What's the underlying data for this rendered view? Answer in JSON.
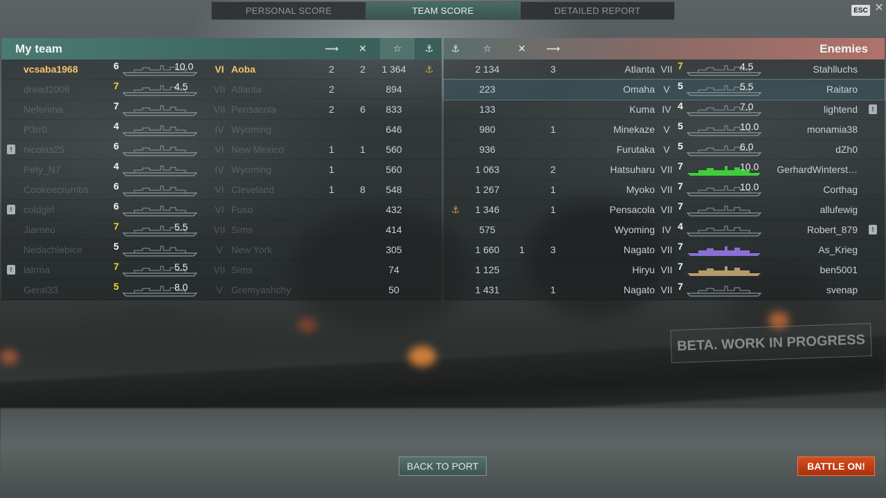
{
  "tabs": [
    {
      "label": "PERSONAL SCORE",
      "active": false
    },
    {
      "label": "TEAM SCORE",
      "active": true
    },
    {
      "label": "DETAILED REPORT",
      "active": false
    }
  ],
  "esc_label": "ESC",
  "my_team": {
    "title": "My team",
    "header_icons": [
      "torpedo-icon",
      "cross-swords-icon",
      "star-icon",
      "anchor-icon"
    ],
    "rows": [
      {
        "report": false,
        "name": "vcsaba1968",
        "tier": "6",
        "tier_color": "white",
        "value": "10.0",
        "ship_tier": "VI",
        "ship": "Aoba",
        "c1": "2",
        "c2": "2",
        "c3": "1 364",
        "c4": "⚓",
        "self": true,
        "dim": false,
        "sil_color": "#8d979c"
      },
      {
        "report": false,
        "name": "dread2006",
        "tier": "7",
        "tier_color": "yellow",
        "value": "4.5",
        "ship_tier": "VII",
        "ship": "Atlanta",
        "c1": "2",
        "c2": "",
        "c3": "894",
        "c4": "",
        "self": false,
        "dim": true,
        "sil_color": "#8d979c"
      },
      {
        "report": false,
        "name": "Neferima",
        "tier": "7",
        "tier_color": "white",
        "value": "",
        "ship_tier": "VII",
        "ship": "Pensacola",
        "c1": "2",
        "c2": "6",
        "c3": "833",
        "c4": "",
        "self": false,
        "dim": true,
        "sil_color": "#8d979c"
      },
      {
        "report": false,
        "name": "P3rr0",
        "tier": "4",
        "tier_color": "white",
        "value": "",
        "ship_tier": "IV",
        "ship": "Wyoming",
        "c1": "",
        "c2": "",
        "c3": "646",
        "c4": "",
        "self": false,
        "dim": true,
        "sil_color": "#8d979c"
      },
      {
        "report": true,
        "name": "nicolas25",
        "tier": "6",
        "tier_color": "white",
        "value": "",
        "ship_tier": "VI",
        "ship": "New Mexico",
        "c1": "1",
        "c2": "1",
        "c3": "560",
        "c4": "",
        "self": false,
        "dim": true,
        "sil_color": "#8d979c"
      },
      {
        "report": false,
        "name": "Pety_N7",
        "tier": "4",
        "tier_color": "white",
        "value": "",
        "ship_tier": "IV",
        "ship": "Wyoming",
        "c1": "1",
        "c2": "",
        "c3": "560",
        "c4": "",
        "self": false,
        "dim": true,
        "sil_color": "#8d979c"
      },
      {
        "report": false,
        "name": "Cookeecrumbs",
        "tier": "6",
        "tier_color": "white",
        "value": "",
        "ship_tier": "VI",
        "ship": "Cleveland",
        "c1": "1",
        "c2": "8",
        "c3": "548",
        "c4": "",
        "self": false,
        "dim": true,
        "sil_color": "#8d979c"
      },
      {
        "report": true,
        "name": "coldgirl",
        "tier": "6",
        "tier_color": "white",
        "value": "",
        "ship_tier": "VI",
        "ship": "Fuso",
        "c1": "",
        "c2": "",
        "c3": "432",
        "c4": "",
        "self": false,
        "dim": true,
        "sil_color": "#8d979c"
      },
      {
        "report": false,
        "name": "Jiarneo",
        "tier": "7",
        "tier_color": "yellow",
        "value": "5.5",
        "ship_tier": "VII",
        "ship": "Sims",
        "c1": "",
        "c2": "",
        "c3": "414",
        "c4": "",
        "self": false,
        "dim": true,
        "sil_color": "#8d979c"
      },
      {
        "report": false,
        "name": "Nedachlebice",
        "tier": "5",
        "tier_color": "white",
        "value": "",
        "ship_tier": "V",
        "ship": "New York",
        "c1": "",
        "c2": "",
        "c3": "305",
        "c4": "",
        "self": false,
        "dim": true,
        "sil_color": "#8d979c"
      },
      {
        "report": true,
        "name": "lalrma",
        "tier": "7",
        "tier_color": "yellow",
        "value": "5.5",
        "ship_tier": "VII",
        "ship": "Sims",
        "c1": "",
        "c2": "",
        "c3": "74",
        "c4": "",
        "self": false,
        "dim": true,
        "sil_color": "#8d979c"
      },
      {
        "report": false,
        "name": "Geral33",
        "tier": "5",
        "tier_color": "yellow",
        "value": "8.0",
        "ship_tier": "V",
        "ship": "Gremyashchy",
        "c1": "",
        "c2": "",
        "c3": "50",
        "c4": "",
        "self": false,
        "dim": true,
        "sil_color": "#8d979c"
      }
    ]
  },
  "enemies": {
    "title": "Enemies",
    "header_icons": [
      "anchor-icon",
      "star-icon",
      "cross-swords-icon",
      "torpedo-icon"
    ],
    "rows": [
      {
        "report": false,
        "name": "Stahlluchs",
        "tier": "7",
        "tier_color": "yellow",
        "value": "4.5",
        "ship_tier": "VII",
        "ship": "Atlanta",
        "c4": "",
        "c3": "2 134",
        "c2": "",
        "c1": "3",
        "dim": false,
        "hl": false,
        "sil_color": "#8d979c"
      },
      {
        "report": false,
        "name": "Raitaro",
        "tier": "5",
        "tier_color": "white",
        "value": "5.5",
        "ship_tier": "V",
        "ship": "Omaha",
        "c4": "",
        "c3": "223",
        "c2": "",
        "c1": "",
        "dim": false,
        "hl": true,
        "sil_color": "#8d979c"
      },
      {
        "report": true,
        "name": "lightend",
        "tier": "4",
        "tier_color": "white",
        "value": "7.0",
        "ship_tier": "IV",
        "ship": "Kuma",
        "c4": "",
        "c3": "133",
        "c2": "",
        "c1": "",
        "dim": false,
        "hl": false,
        "sil_color": "#8d979c"
      },
      {
        "report": false,
        "name": "monamia38",
        "tier": "5",
        "tier_color": "white",
        "value": "10.0",
        "ship_tier": "V",
        "ship": "Minekaze",
        "c4": "",
        "c3": "980",
        "c2": "",
        "c1": "1",
        "dim": false,
        "hl": false,
        "sil_color": "#8d979c"
      },
      {
        "report": false,
        "name": "dZh0",
        "tier": "5",
        "tier_color": "white",
        "value": "6.0",
        "ship_tier": "V",
        "ship": "Furutaka",
        "c4": "",
        "c3": "936",
        "c2": "",
        "c1": "",
        "dim": false,
        "hl": false,
        "sil_color": "#8d979c"
      },
      {
        "report": false,
        "name": "GerhardWinterst…",
        "tier": "7",
        "tier_color": "white",
        "value": "10.0",
        "ship_tier": "VII",
        "ship": "Hatsuharu",
        "c4": "",
        "c3": "1 063",
        "c2": "",
        "c1": "2",
        "dim": false,
        "hl": false,
        "sil_color": "#3fce3a"
      },
      {
        "report": false,
        "name": "Corthag",
        "tier": "7",
        "tier_color": "white",
        "value": "10.0",
        "ship_tier": "VII",
        "ship": "Myoko",
        "c4": "",
        "c3": "1 267",
        "c2": "",
        "c1": "1",
        "dim": false,
        "hl": false,
        "sil_color": "#8d979c"
      },
      {
        "report": false,
        "name": "allufewig",
        "tier": "7",
        "tier_color": "white",
        "value": "",
        "ship_tier": "VII",
        "ship": "Pensacola",
        "c4": "⚓",
        "c3": "1 346",
        "c2": "",
        "c1": "1",
        "dim": false,
        "hl": false,
        "sil_color": "#8d979c"
      },
      {
        "report": true,
        "name": "Robert_879",
        "tier": "4",
        "tier_color": "white",
        "value": "",
        "ship_tier": "IV",
        "ship": "Wyoming",
        "c4": "",
        "c3": "575",
        "c2": "",
        "c1": "",
        "dim": false,
        "hl": false,
        "sil_color": "#8d979c"
      },
      {
        "report": false,
        "name": "As_Krieg",
        "tier": "7",
        "tier_color": "white",
        "value": "",
        "ship_tier": "VII",
        "ship": "Nagato",
        "c4": "",
        "c3": "1 660",
        "c2": "1",
        "c1": "3",
        "dim": false,
        "hl": false,
        "sil_color": "#8a6fd6"
      },
      {
        "report": false,
        "name": "ben5001",
        "tier": "7",
        "tier_color": "white",
        "value": "",
        "ship_tier": "VII",
        "ship": "Hiryu",
        "c4": "",
        "c3": "1 125",
        "c2": "",
        "c1": "",
        "dim": false,
        "hl": false,
        "sil_color": "#b89a6a"
      },
      {
        "report": false,
        "name": "svenap",
        "tier": "7",
        "tier_color": "white",
        "value": "",
        "ship_tier": "VII",
        "ship": "Nagato",
        "c4": "",
        "c3": "1 431",
        "c2": "",
        "c1": "1",
        "dim": false,
        "hl": false,
        "sil_color": "#8d979c"
      }
    ]
  },
  "watermark": "BETA. WORK IN PROGRESS",
  "buttons": {
    "back_to_port": "BACK TO PORT",
    "battle_on": "BATTLE ON!"
  },
  "colors": {
    "accent_team": "#4b7a72",
    "accent_enemy": "#b0726a",
    "self_name": "#f2c56a",
    "tier_yellow": "#f2d632",
    "battle_button": "#d94c1c"
  }
}
